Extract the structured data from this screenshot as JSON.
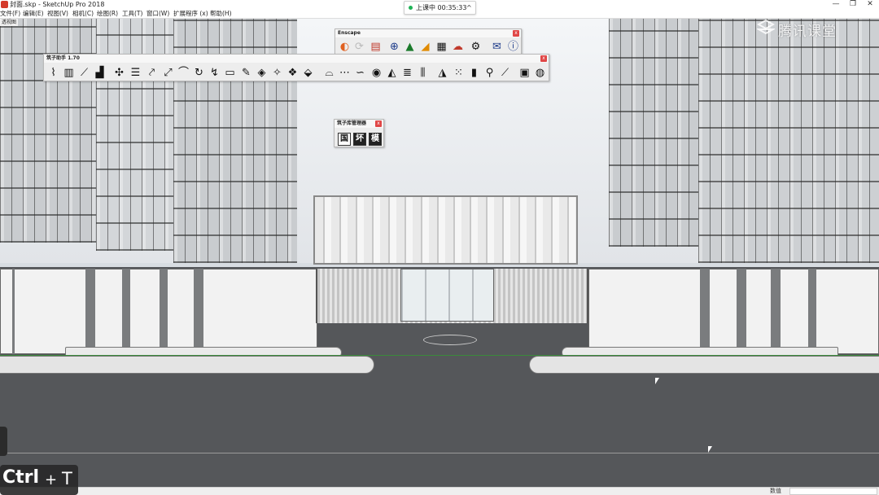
{
  "window": {
    "title": "封面.skp - SketchUp Pro 2018",
    "controls": [
      "—",
      "❐",
      "✕"
    ]
  },
  "menu": [
    {
      "label": "文件(F)"
    },
    {
      "label": "编辑(E)"
    },
    {
      "label": "视图(V)"
    },
    {
      "label": "相机(C)"
    },
    {
      "label": "绘图(R)"
    },
    {
      "label": "工具(T)"
    },
    {
      "label": "窗口(W)"
    },
    {
      "label": "扩展程序 (x)"
    },
    {
      "label": "帮助(H)"
    }
  ],
  "live_status": {
    "text": "上课中 00:35:33",
    "chevron": "^"
  },
  "scene_tag": "透视图",
  "watermark": "腾讯课堂",
  "toolbars": {
    "enscape": {
      "title": "Enscape",
      "close": "x",
      "icons": [
        "enscape-start-icon",
        "refresh-icon",
        "views-icon",
        "add-icon",
        "tree-icon",
        "material-icon",
        "checker-icon",
        "cloud-upload-icon",
        "settings-icon",
        "feedback-mail-icon",
        "info-icon"
      ]
    },
    "zhuzi": {
      "title": "筑子助手 1.70",
      "close": "x",
      "icons": [
        "stair-icon",
        "railing-icon",
        "ramp-icon",
        "steps-icon",
        "sun-icon",
        "slab-icon",
        "walker-icon",
        "runner-icon",
        "arch-icon",
        "rotate-icon",
        "follow-icon",
        "roof-icon",
        "pen-icon",
        "diamond-icon",
        "tangram-icon",
        "stack-icon",
        "bucket-icon",
        "arc-icon",
        "chain-icon",
        "rope-icon",
        "ring-icon",
        "flag-icon",
        "road-icon",
        "column-icon",
        "mirror-icon",
        "grid-icon",
        "tower-icon",
        "walk-icon",
        "broom-icon",
        "frame-icon",
        "globe-icon"
      ]
    },
    "library": {
      "title": "筑子库管理器",
      "close": "x",
      "buttons": [
        {
          "label": "国"
        },
        {
          "label": "坏"
        },
        {
          "label": "模"
        }
      ]
    }
  },
  "status": {
    "value_label": "数值",
    "value": ""
  },
  "key_overlay": {
    "key1": "Ctrl",
    "plus": "+",
    "key2": "T"
  }
}
